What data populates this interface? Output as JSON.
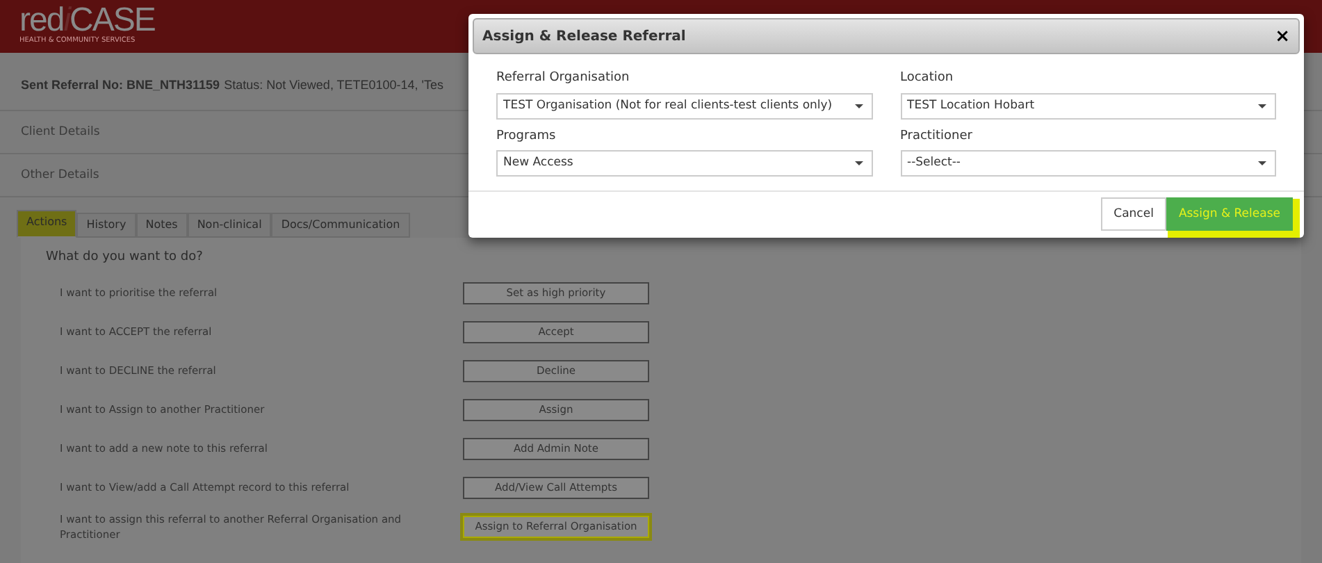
{
  "logo": {
    "prefix": "red",
    "mark": "i",
    "suffix": "CASE",
    "tagline": "HEALTH & COMMUNITY SERVICES"
  },
  "referral_header": {
    "title": "Sent Referral No: BNE_NTH31159",
    "status": "Status: Not Viewed, TETE0100-14, 'Tes"
  },
  "sections": [
    "Client Details",
    "Other Details"
  ],
  "tabs": [
    {
      "label": "Actions",
      "selected": true,
      "highlighted": true
    },
    {
      "label": "History",
      "selected": false,
      "highlighted": false
    },
    {
      "label": "Notes",
      "selected": false,
      "highlighted": false
    },
    {
      "label": "Non-clinical",
      "selected": false,
      "highlighted": false
    },
    {
      "label": "Docs/Communication",
      "selected": false,
      "highlighted": false
    }
  ],
  "question": "What do you want to do?",
  "actions": [
    {
      "text": "I want to prioritise the referral",
      "button": "Set as high priority",
      "highlighted": false
    },
    {
      "text": "I want to ACCEPT the referral",
      "button": "Accept",
      "highlighted": false
    },
    {
      "text": "I want to DECLINE the referral",
      "button": "Decline",
      "highlighted": false
    },
    {
      "text": "I want to Assign to another Practitioner",
      "button": "Assign",
      "highlighted": false
    },
    {
      "text": "I want to add a new note to this referral",
      "button": "Add Admin Note",
      "highlighted": false
    },
    {
      "text": "I want to View/add a Call Attempt record to this referral",
      "button": "Add/View Call Attempts",
      "highlighted": false
    },
    {
      "text": "I want to assign this referral to another Referral Organisation and Practitioner",
      "button": "Assign to Referral Organisation",
      "highlighted": true
    }
  ],
  "dialog": {
    "title": "Assign & Release Referral",
    "close": "×",
    "fields": [
      {
        "label": "Referral Organisation",
        "value": "TEST Organisation (Not for real clients-test clients only)"
      },
      {
        "label": "Location",
        "value": "TEST Location Hobart"
      },
      {
        "label": "Programs",
        "value": "New Access"
      },
      {
        "label": "Practitioner",
        "value": "--Select--"
      }
    ],
    "buttons": [
      {
        "label": "Cancel",
        "kind": "secondary",
        "highlighted": false
      },
      {
        "label": "Assign & Release",
        "kind": "primary",
        "highlighted": true
      }
    ]
  }
}
